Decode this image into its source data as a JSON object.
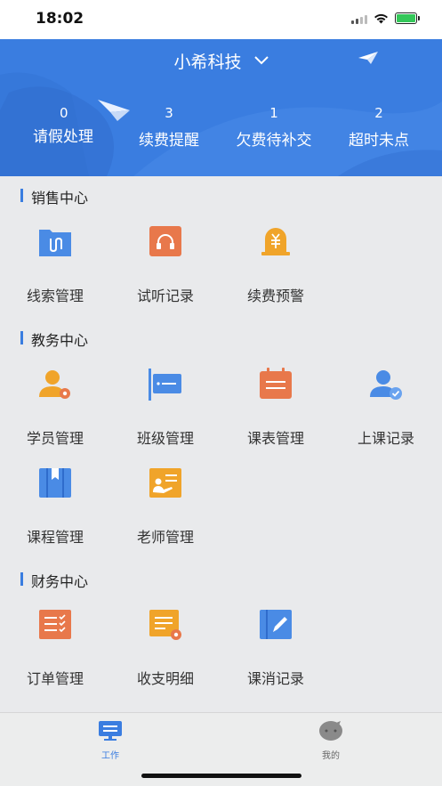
{
  "status_bar": {
    "time": "18:02"
  },
  "header": {
    "org_name": "小希科技",
    "stats": [
      {
        "count": "0",
        "label": "请假处理"
      },
      {
        "count": "3",
        "label": "续费提醒"
      },
      {
        "count": "1",
        "label": "欠费待补交"
      },
      {
        "count": "2",
        "label": "超时未点"
      }
    ]
  },
  "sections": {
    "sales": {
      "title": "销售中心",
      "items": [
        {
          "label": "线索管理",
          "icon": "clue-icon",
          "color": "#4a8be5"
        },
        {
          "label": "试听记录",
          "icon": "headphones-icon",
          "color": "#e8784b"
        },
        {
          "label": "续费预警",
          "icon": "yen-bell-icon",
          "color": "#f0a42a"
        }
      ]
    },
    "academic": {
      "title": "教务中心",
      "items": [
        {
          "label": "学员管理",
          "icon": "student-gear-icon",
          "color": "#f0a42a"
        },
        {
          "label": "班级管理",
          "icon": "class-sign-icon",
          "color": "#4a8be5"
        },
        {
          "label": "课表管理",
          "icon": "calendar-icon",
          "color": "#e8784b"
        },
        {
          "label": "上课记录",
          "icon": "attendance-check-icon",
          "color": "#4a8be5"
        },
        {
          "label": "课程管理",
          "icon": "book-icon",
          "color": "#4a8be5"
        },
        {
          "label": "老师管理",
          "icon": "teacher-board-icon",
          "color": "#f0a42a"
        }
      ]
    },
    "finance": {
      "title": "财务中心",
      "items": [
        {
          "label": "订单管理",
          "icon": "order-list-icon",
          "color": "#e8784b"
        },
        {
          "label": "收支明细",
          "icon": "ledger-gear-icon",
          "color": "#f0a42a"
        },
        {
          "label": "课消记录",
          "icon": "pen-note-icon",
          "color": "#4a8be5"
        }
      ]
    }
  },
  "tab_bar": {
    "work": "工作",
    "mine": "我的",
    "active_color": "#3a7de0"
  }
}
